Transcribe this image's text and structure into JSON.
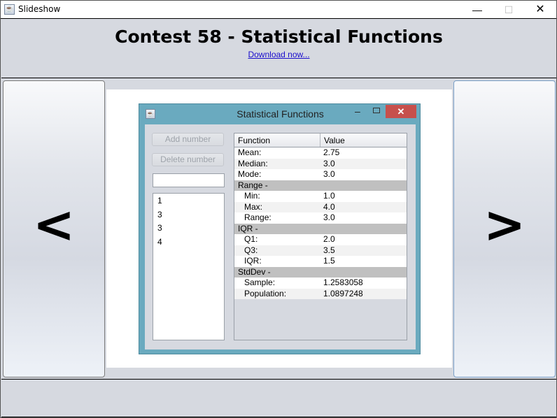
{
  "window": {
    "title": "Slideshow",
    "icon": "java-icon",
    "controls": {
      "minimize": "—",
      "maximize": "☐",
      "close": "✕"
    }
  },
  "header": {
    "title": "Contest 58 - Statistical Functions",
    "link": "Download now..."
  },
  "nav": {
    "prev": "<",
    "next": ">"
  },
  "slide": {
    "window_title": "Statistical Functions",
    "controls": {
      "minimize": "–",
      "close": "✕"
    },
    "buttons": {
      "add": "Add number",
      "delete": "Delete number"
    },
    "input_value": "",
    "numbers": [
      "1",
      "3",
      "3",
      "4"
    ],
    "table": {
      "headers": [
        "Function",
        "Value"
      ],
      "rows": [
        {
          "type": "item",
          "label": "Mean:",
          "value": "2.75"
        },
        {
          "type": "item",
          "label": "Median:",
          "value": "3.0"
        },
        {
          "type": "item",
          "label": "Mode:",
          "value": "3.0"
        },
        {
          "type": "group",
          "label": "Range -",
          "value": ""
        },
        {
          "type": "sub",
          "label": "Min:",
          "value": "1.0"
        },
        {
          "type": "sub",
          "label": "Max:",
          "value": "4.0"
        },
        {
          "type": "sub",
          "label": "Range:",
          "value": "3.0"
        },
        {
          "type": "group",
          "label": "IQR -",
          "value": ""
        },
        {
          "type": "sub",
          "label": "Q1:",
          "value": "2.0"
        },
        {
          "type": "sub",
          "label": "Q3:",
          "value": "3.5"
        },
        {
          "type": "sub",
          "label": "IQR:",
          "value": "1.5"
        },
        {
          "type": "group",
          "label": "StdDev -",
          "value": ""
        },
        {
          "type": "sub",
          "label": "Sample:",
          "value": "1.2583058"
        },
        {
          "type": "sub",
          "label": "Population:",
          "value": "1.0897248"
        }
      ]
    }
  }
}
